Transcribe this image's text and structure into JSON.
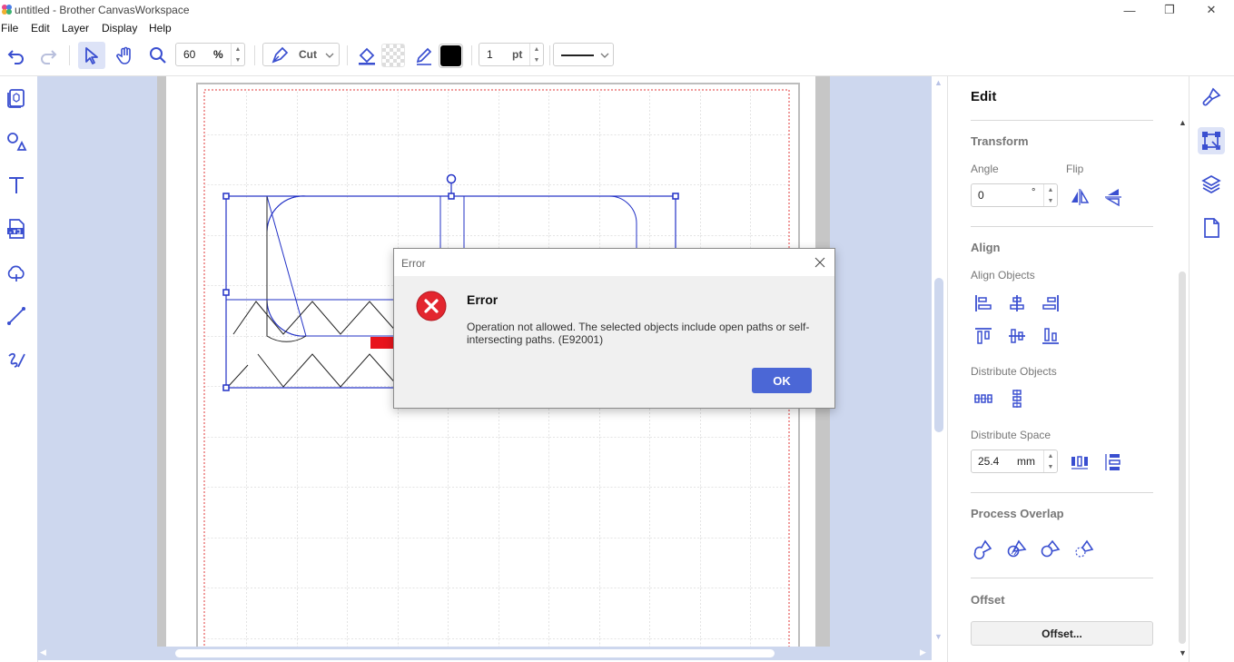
{
  "window": {
    "title": "untitled - Brother CanvasWorkspace",
    "minimize_glyph": "—",
    "restore_glyph": "❐",
    "close_glyph": "✕"
  },
  "menu": [
    "File",
    "Edit",
    "Layer",
    "Display",
    "Help"
  ],
  "toolbar": {
    "zoom_value": "60",
    "zoom_unit": "%",
    "mode_value": "Cut",
    "line_width_value": "1",
    "line_width_unit": "pt",
    "line_color": "#000000"
  },
  "dialog": {
    "title": "Error",
    "heading": "Error",
    "message": "Operation not allowed. The selected objects include open paths or self-intersecting paths. (E92001)",
    "ok_label": "OK",
    "accent": "#4b67d6",
    "error_color": "#e3262f"
  },
  "panel": {
    "title": "Edit",
    "transform_title": "Transform",
    "angle_label": "Angle",
    "angle_value": "0",
    "angle_unit": "°",
    "flip_label": "Flip",
    "align_title": "Align",
    "align_objects_label": "Align Objects",
    "distribute_objects_label": "Distribute Objects",
    "distribute_space_label": "Distribute Space",
    "distribute_space_value": "25.4",
    "distribute_space_unit": "mm",
    "process_overlap_title": "Process Overlap",
    "offset_title": "Offset",
    "offset_button": "Offset..."
  },
  "colors": {
    "accent": "#3a4fd0",
    "canvas_bg": "#cdd7ee",
    "selection": "#2231c6",
    "arrow": "#e8141c"
  }
}
